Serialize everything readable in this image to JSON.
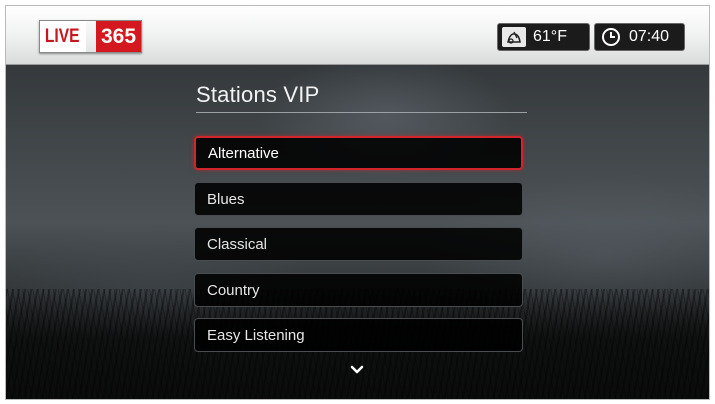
{
  "header": {
    "logo": {
      "live": "LIVE",
      "number": "365"
    },
    "weather": {
      "icon": "weather-icon",
      "temperature": "61°F"
    },
    "clock": {
      "icon": "clock-icon",
      "time": "07:40"
    }
  },
  "page": {
    "title": "Stations VIP"
  },
  "menu": {
    "items": [
      {
        "label": "Alternative",
        "selected": true
      },
      {
        "label": "Blues",
        "selected": false
      },
      {
        "label": "Classical",
        "selected": false
      },
      {
        "label": "Country",
        "selected": false
      },
      {
        "label": "Easy Listening",
        "selected": false
      }
    ],
    "more_indicator": "chevron-down-icon"
  },
  "colors": {
    "accent": "#d0252b",
    "logo_red": "#d4181f",
    "item_bg": "#000000",
    "topbar": "#f1f2f2"
  }
}
